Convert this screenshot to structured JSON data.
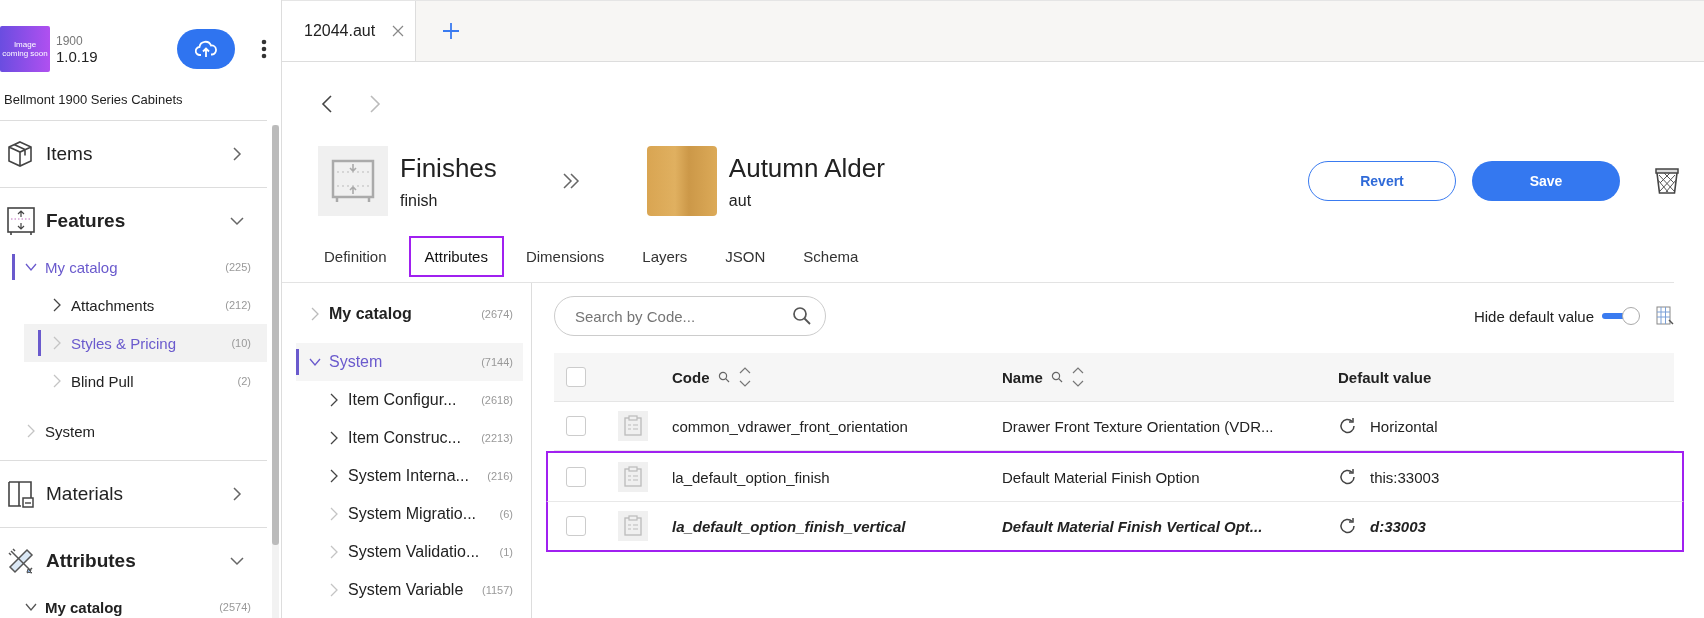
{
  "app": {
    "logo_text": "Image coming soon",
    "series": "1900",
    "version": "1.0.19",
    "catalog_name": "Bellmont 1900 Series Cabinets"
  },
  "sidebar": {
    "sections": [
      {
        "label": "Items",
        "kind": "cube",
        "expanded": false
      },
      {
        "label": "Features",
        "kind": "frame",
        "expanded": true,
        "children": [
          {
            "label": "My catalog",
            "count": "(225)",
            "expanded": true,
            "selected": false,
            "active": true,
            "children": [
              {
                "label": "Attachments",
                "count": "(212)",
                "expanded": false,
                "selected": false,
                "active": false,
                "has_children": true
              },
              {
                "label": "Styles & Pricing",
                "count": "(10)",
                "expanded": false,
                "selected": true,
                "active": true,
                "has_children": false
              },
              {
                "label": "Blind Pull",
                "count": "(2)",
                "expanded": false,
                "selected": false,
                "active": false,
                "has_children": false
              }
            ]
          },
          {
            "label": "System",
            "expanded": false,
            "selected": false,
            "active": false,
            "has_children": false
          }
        ]
      },
      {
        "label": "Materials",
        "kind": "panel",
        "expanded": false
      },
      {
        "label": "Attributes",
        "kind": "tools",
        "expanded": true,
        "children": [
          {
            "label": "My catalog",
            "count": "(2574)",
            "expanded": true,
            "selected": false,
            "active": false,
            "bold": true
          }
        ]
      }
    ]
  },
  "tabs": [
    {
      "label": "12044.aut",
      "selected": true
    }
  ],
  "header": {
    "parent_title": "Finishes",
    "parent_code": "finish",
    "title": "Autumn Alder",
    "code": "aut",
    "revert": "Revert",
    "save": "Save"
  },
  "section_tabs": [
    {
      "label": "Definition",
      "selected": false,
      "highlighted": false
    },
    {
      "label": "Attributes",
      "selected": true,
      "highlighted": true
    },
    {
      "label": "Dimensions",
      "selected": false,
      "highlighted": false
    },
    {
      "label": "Layers",
      "selected": false,
      "highlighted": false
    },
    {
      "label": "JSON",
      "selected": false,
      "highlighted": false
    },
    {
      "label": "Schema",
      "selected": false,
      "highlighted": false
    }
  ],
  "tree": [
    {
      "label": "My catalog",
      "count": "(2674)",
      "expanded": false,
      "selected": false,
      "bold": true,
      "has_children": false
    },
    {
      "label": "System",
      "count": "(7144)",
      "expanded": true,
      "selected": true,
      "bold": false,
      "children": [
        {
          "label": "Item Configur...",
          "count": "(2618)",
          "has_children": true
        },
        {
          "label": "Item Construc...",
          "count": "(2213)",
          "has_children": true
        },
        {
          "label": "System Interna...",
          "count": "(216)",
          "has_children": true
        },
        {
          "label": "System Migratio...",
          "count": "(6)",
          "has_children": false
        },
        {
          "label": "System Validatio...",
          "count": "(1)",
          "has_children": false
        },
        {
          "label": "System Variable",
          "count": "(1157)",
          "has_children": false
        }
      ]
    }
  ],
  "search": {
    "placeholder": "Search by Code..."
  },
  "hide_default": {
    "label": "Hide default value",
    "on": true
  },
  "table": {
    "all_checked": false,
    "columns": [
      {
        "label": "Code",
        "searchable": true,
        "sortable": true
      },
      {
        "label": "Name",
        "searchable": true,
        "sortable": true
      },
      {
        "label": "Default value",
        "searchable": false,
        "sortable": false
      }
    ],
    "rows": [
      {
        "checked": false,
        "code": "common_vdrawer_front_orientation",
        "name": "Drawer Front Texture Orientation (VDR...",
        "value": "Horizontal",
        "highlighted": false,
        "emphasized": false
      },
      {
        "checked": false,
        "code": "la_default_option_finish",
        "name": "Default Material Finish Option",
        "value": "this:33003",
        "highlighted": true,
        "emphasized": false
      },
      {
        "checked": false,
        "code": "la_default_option_finish_vertical",
        "name": "Default Material Finish Vertical Opt...",
        "value": "d:33003",
        "highlighted": true,
        "emphasized": true
      }
    ]
  }
}
